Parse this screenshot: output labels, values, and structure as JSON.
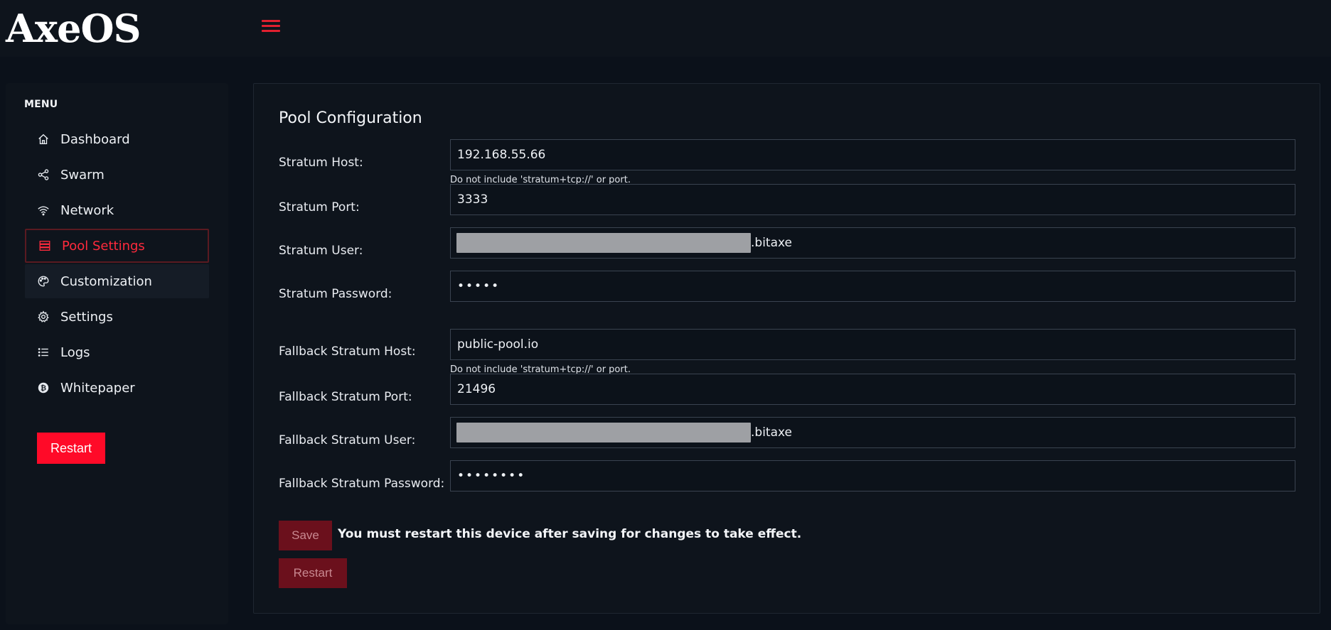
{
  "app": {
    "logo_text": "AxeOS"
  },
  "sidebar": {
    "menu_title": "MENU",
    "items": [
      {
        "label": "Dashboard",
        "icon": "home-icon"
      },
      {
        "label": "Swarm",
        "icon": "share-icon"
      },
      {
        "label": "Network",
        "icon": "wifi-icon"
      },
      {
        "label": "Pool Settings",
        "icon": "server-icon",
        "active": true
      },
      {
        "label": "Customization",
        "icon": "palette-icon"
      },
      {
        "label": "Settings",
        "icon": "gear-icon"
      },
      {
        "label": "Logs",
        "icon": "list-icon"
      },
      {
        "label": "Whitepaper",
        "icon": "bitcoin-icon"
      }
    ],
    "restart_label": "Restart"
  },
  "pool": {
    "title": "Pool Configuration",
    "stratum_host_label": "Stratum Host:",
    "stratum_host_value": "192.168.55.66",
    "stratum_host_hint": "Do not include 'stratum+tcp://' or port.",
    "stratum_port_label": "Stratum Port:",
    "stratum_port_value": "3333",
    "stratum_user_label": "Stratum User:",
    "stratum_user_suffix": ".bitaxe",
    "stratum_password_label": "Stratum Password:",
    "stratum_password_value": "•••••",
    "fallback_host_label": "Fallback Stratum Host:",
    "fallback_host_value": "public-pool.io",
    "fallback_host_hint": "Do not include 'stratum+tcp://' or port.",
    "fallback_port_label": "Fallback Stratum Port:",
    "fallback_port_value": "21496",
    "fallback_user_label": "Fallback Stratum User:",
    "fallback_user_suffix": ".bitaxe",
    "fallback_password_label": "Fallback Stratum Password:",
    "fallback_password_value": "••••••••",
    "save_label": "Save",
    "save_note": "You must restart this device after saving for changes to take effect.",
    "restart_label": "Restart"
  },
  "colors": {
    "accent": "#ff0a28",
    "background": "#0b111a",
    "panel": "#0e141c"
  }
}
